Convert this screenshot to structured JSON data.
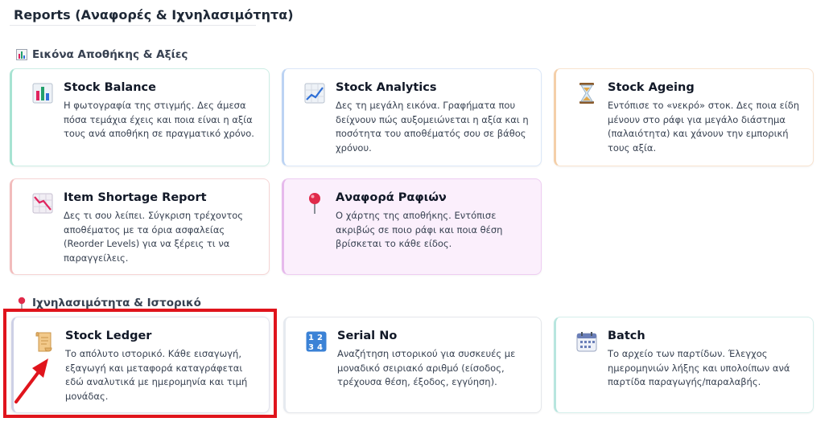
{
  "page": {
    "title": "Reports (Αναφορές & Ιχνηλασιμότητα)"
  },
  "sections": [
    {
      "title": "Εικόνα Αποθήκης & Αξίες",
      "icon": "bar-chart-icon"
    },
    {
      "title": "Ιχνηλασιμότητα & Ιστορικό",
      "icon": "pushpin-icon"
    }
  ],
  "cards": {
    "stock_balance": {
      "title": "Stock Balance",
      "icon": "bar-chart-icon",
      "desc": "Η φωτογραφία της στιγμής. Δες άμεσα πόσα τεμάχια έχεις και ποια είναι η αξία τους ανά αποθήκη σε πραγματικό χρόνο."
    },
    "stock_analytics": {
      "title": "Stock Analytics",
      "icon": "line-chart-icon",
      "desc": "Δες τη μεγάλη εικόνα. Γραφήματα που δείχνουν πώς αυξομειώνεται η αξία και η ποσότητα του αποθέματός σου σε βάθος χρόνου."
    },
    "stock_ageing": {
      "title": "Stock Ageing",
      "icon": "hourglass-icon",
      "desc": "Εντόπισε το «νεκρό» στοκ. Δες ποια είδη μένουν στο ράφι για μεγάλο διάστημα (παλαιότητα) και χάνουν την εμπορική τους αξία."
    },
    "item_shortage": {
      "title": "Item Shortage Report",
      "icon": "declining-chart-icon",
      "desc": "Δες τι σου λείπει. Σύγκριση τρέχοντος αποθέματος με τα όρια ασφαλείας (Reorder Levels) για να ξέρεις τι να παραγγείλεις."
    },
    "shelf_report": {
      "title": "Αναφορά Ραφιών",
      "icon": "round-pushpin-icon",
      "desc": "Ο χάρτης της αποθήκης. Εντόπισε ακριβώς σε ποιο ράφι και ποια θέση βρίσκεται το κάθε είδος."
    },
    "stock_ledger": {
      "title": "Stock Ledger",
      "icon": "scroll-icon",
      "desc": "Το απόλυτο ιστορικό. Κάθε εισαγωγή, εξαγωγή και μεταφορά καταγράφεται εδώ αναλυτικά με ημερομηνία και τιμή μονάδας."
    },
    "serial_no": {
      "title": "Serial No",
      "icon": "numbers-icon",
      "desc": "Αναζήτηση ιστορικού για συσκευές με μοναδικό σειριακό αριθμό (είσοδος, τρέχουσα θέση, έξοδος, εγγύηση)."
    },
    "batch": {
      "title": "Batch",
      "icon": "calendar-icon",
      "desc": "Το αρχείο των παρτίδων. Έλεγχος ημερομηνιών λήξης και υπολοίπων ανά παρτίδα παραγωγής/παραλαβής."
    }
  },
  "colors": {
    "highlight": "#e0141c",
    "arrow": "#e0141c"
  }
}
